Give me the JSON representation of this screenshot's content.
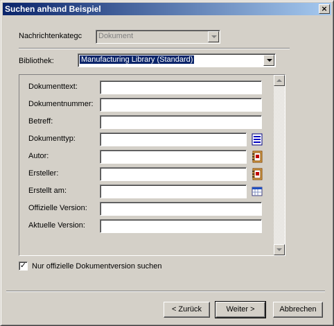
{
  "window": {
    "title": "Suchen anhand Beispiel",
    "close_glyph": "×"
  },
  "category": {
    "label": "Nachrichtenkategc",
    "value": "Dokument"
  },
  "library": {
    "label": "Bibliothek:",
    "value": "Manufacturing Library  (Standard)"
  },
  "fields": [
    {
      "label": "Dokumenttext:",
      "value": ""
    },
    {
      "label": "Dokumentnummer:",
      "value": ""
    },
    {
      "label": "Betreff:",
      "value": ""
    },
    {
      "label": "Dokumenttyp:",
      "value": "",
      "icon": "list-picker-icon"
    },
    {
      "label": "Autor:",
      "value": "",
      "icon": "address-book-icon"
    },
    {
      "label": "Ersteller:",
      "value": "",
      "icon": "address-book-icon"
    },
    {
      "label": "Erstellt am:",
      "value": "",
      "icon": "calendar-icon"
    },
    {
      "label": "Offizielle Version:",
      "value": ""
    },
    {
      "label": "Aktuelle Version:",
      "value": ""
    }
  ],
  "checkbox": {
    "label": "Nur offizielle Dokumentversion suchen",
    "checked": true,
    "glyph": "✓"
  },
  "buttons": {
    "back": "< Zurück",
    "next": "Weiter >",
    "cancel": "Abbrechen"
  },
  "colors": {
    "title_start": "#0a246a",
    "title_end": "#a6caf0",
    "face": "#d4d0c8",
    "selection": "#0a246a"
  }
}
